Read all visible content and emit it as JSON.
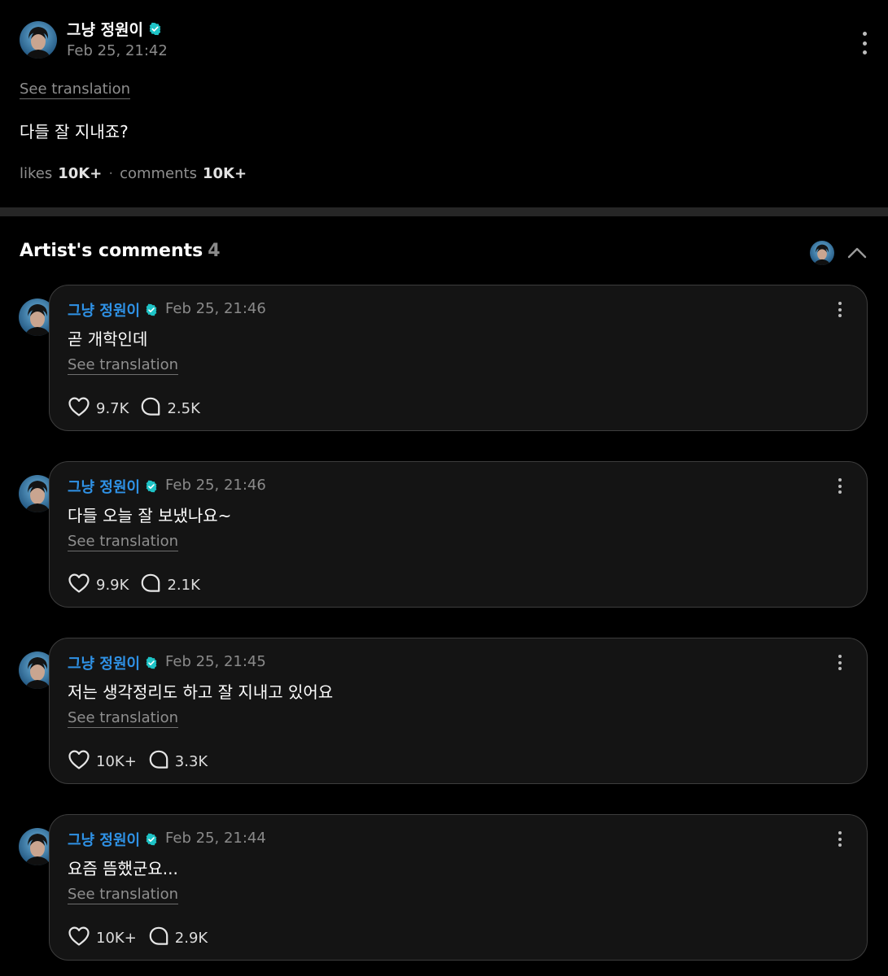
{
  "post": {
    "author": "그냥 정원이",
    "date": "Feb 25, 21:42",
    "see_translation": "See translation",
    "body": "다들 잘 지내죠?",
    "likes_label": "likes",
    "likes_value": "10K+",
    "separator": "·",
    "comments_label": "comments",
    "comments_value": "10K+"
  },
  "section": {
    "title": "Artist's comments",
    "count": "4"
  },
  "comments": [
    {
      "author": "그냥 정원이",
      "date": "Feb 25, 21:46",
      "body": "곧 개학인데",
      "see_translation": "See translation",
      "likes": "9.7K",
      "replies": "2.5K"
    },
    {
      "author": "그냥 정원이",
      "date": "Feb 25, 21:46",
      "body": "다들 오늘 잘 보냈나요~",
      "see_translation": "See translation",
      "likes": "9.9K",
      "replies": "2.1K"
    },
    {
      "author": "그냥 정원이",
      "date": "Feb 25, 21:45",
      "body": "저는 생각정리도 하고 잘 지내고 있어요",
      "see_translation": "See translation",
      "likes": "10K+",
      "replies": "3.3K"
    },
    {
      "author": "그냥 정원이",
      "date": "Feb 25, 21:44",
      "body": "요즘 뜸했군요...",
      "see_translation": "See translation",
      "likes": "10K+",
      "replies": "2.9K"
    }
  ],
  "icons": {
    "verified": "verified-check-icon",
    "more": "kebab-menu-icon",
    "like": "heart-icon",
    "reply": "comment-bubble-icon",
    "collapse": "chevron-up-icon"
  },
  "colors": {
    "background": "#000000",
    "card": "#141414",
    "card_border": "#3d3d3d",
    "verified": "#1ec3c6",
    "comment_author": "#2f92e6",
    "divider": "#262626"
  }
}
